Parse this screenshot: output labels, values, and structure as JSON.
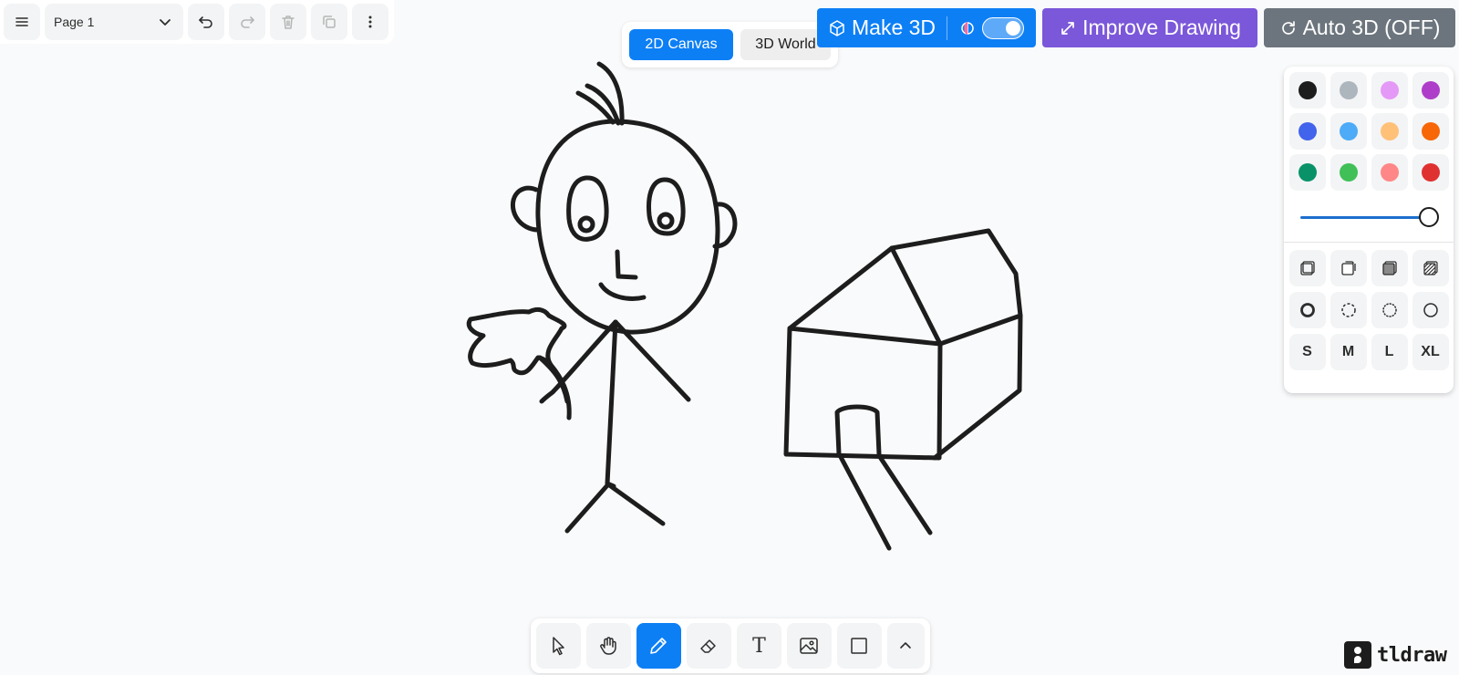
{
  "menu": {
    "page_label": "Page 1",
    "icons": [
      "hamburger-menu-icon",
      "chevron-down-icon",
      "undo-icon",
      "redo-icon",
      "trash-icon",
      "duplicate-icon",
      "more-vertical-icon"
    ]
  },
  "mode_switch": {
    "canvas_2d": "2D Canvas",
    "world_3d": "3D World",
    "active": "2D Canvas"
  },
  "actions": {
    "make3d_label": "Make 3D",
    "make3d_toggle_on": true,
    "improve_label": "Improve Drawing",
    "auto3d_label": "Auto 3D (OFF)"
  },
  "style_panel": {
    "colors": [
      "#1d1d1d",
      "#adb5bd",
      "#e599f7",
      "#ae3ec9",
      "#4263eb",
      "#4dabf7",
      "#ffc078",
      "#f76707",
      "#099268",
      "#40c057",
      "#ff8787",
      "#e03131"
    ],
    "selected_color": "#1d1d1d",
    "opacity": 1.0,
    "fill_options": [
      "fill-none-icon",
      "fill-semi-icon",
      "fill-solid-icon",
      "fill-pattern-icon"
    ],
    "dash_options": [
      "dash-draw-icon",
      "dash-dashed-icon",
      "dash-dotted-icon",
      "dash-solid-icon"
    ],
    "sizes": [
      "S",
      "M",
      "L",
      "XL"
    ]
  },
  "toolbar": {
    "tools": [
      "select-tool",
      "hand-tool",
      "draw-tool",
      "eraser-tool",
      "text-tool",
      "media-tool",
      "rectangle-tool",
      "more-tools"
    ],
    "active_tool": "draw-tool",
    "text_tool_glyph": "T"
  },
  "watermark": {
    "text": "tldraw"
  },
  "colors": {
    "accent": "#0d7ff5",
    "improve": "#7b57d9",
    "auto3d": "#6c757d",
    "ink": "#1d1d1d"
  }
}
